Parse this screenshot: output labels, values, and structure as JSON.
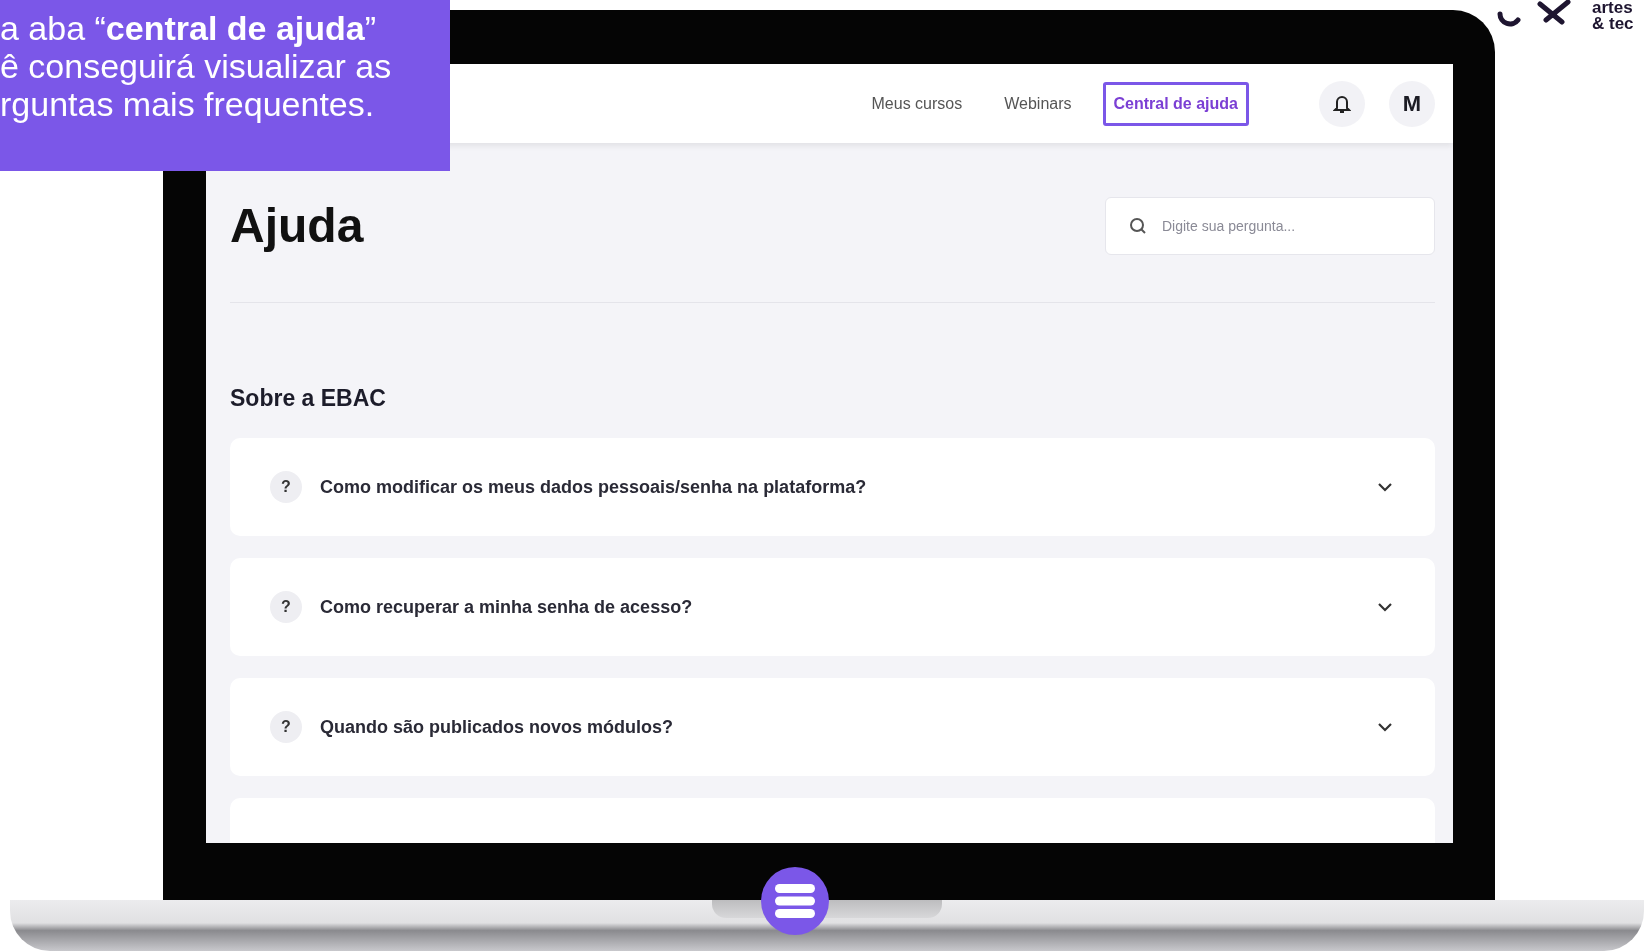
{
  "caption": {
    "lines": [
      "a aba “**central de ajuda**”",
      "ê conseguirá visualizar as",
      "rguntas mais frequentes."
    ]
  },
  "logo": {
    "lines": [
      "artes",
      "& tec"
    ]
  },
  "nav": {
    "links": [
      {
        "label": "Meus cursos",
        "selected": false
      },
      {
        "label": "Webinars",
        "selected": false
      },
      {
        "label": "Central de ajuda",
        "selected": true
      }
    ],
    "avatar": "M"
  },
  "page": {
    "title": "Ajuda",
    "search": {
      "placeholder": "Digite sua pergunta..."
    },
    "section": "Sobre a EBAC",
    "questions": [
      {
        "icon": "?",
        "text": "Como modificar os meus dados pessoais/senha na plataforma?",
        "expanded": false
      },
      {
        "icon": "?",
        "text": "Como recuperar a minha senha de acesso?",
        "expanded": false
      },
      {
        "icon": "?",
        "text": "Quando são publicados novos módulos?",
        "expanded": false
      }
    ]
  }
}
